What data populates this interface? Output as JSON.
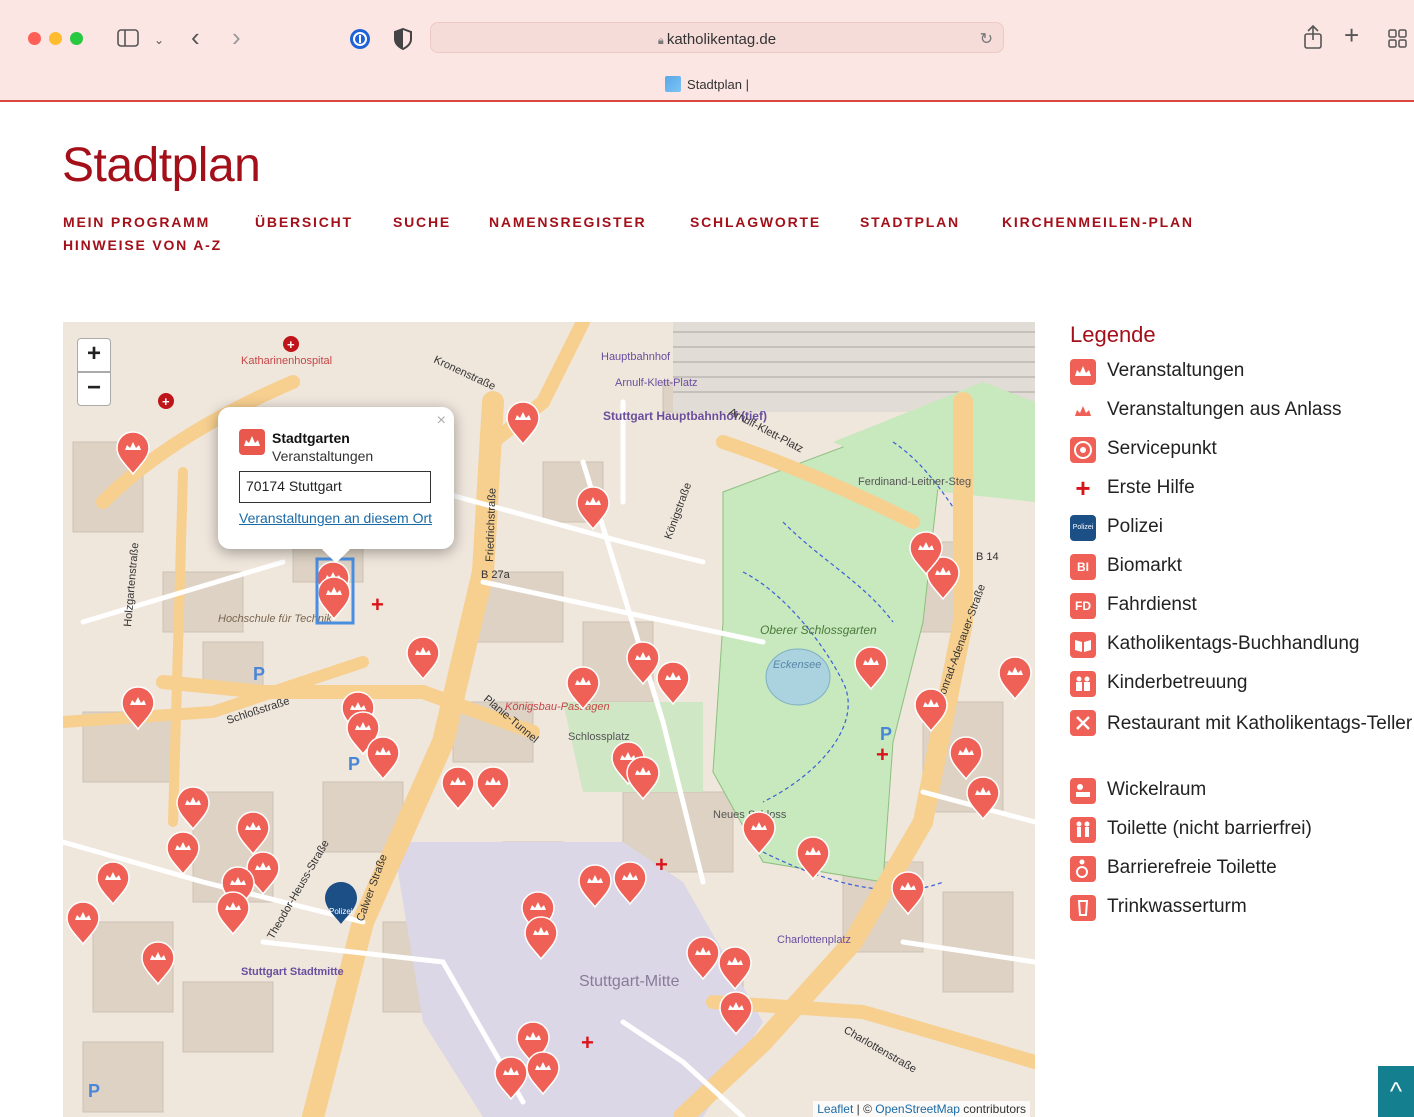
{
  "browser": {
    "url": "katholikentag.de",
    "tab_title": "Stadtplan |"
  },
  "page": {
    "title": "Stadtplan"
  },
  "nav": [
    {
      "label": "MEIN PROGRAMM"
    },
    {
      "label": "ÜBERSICHT"
    },
    {
      "label": "SUCHE"
    },
    {
      "label": "NAMENSREGISTER"
    },
    {
      "label": "SCHLAGWORTE"
    },
    {
      "label": "STADTPLAN"
    },
    {
      "label": "KIRCHENMEILEN-PLAN"
    },
    {
      "label": "HINWEISE VON A-Z"
    }
  ],
  "map": {
    "zoom_in": "+",
    "zoom_out": "−",
    "popup": {
      "close": "×",
      "name": "Stadtgarten",
      "type": "Veranstaltungen",
      "address": "70174 Stuttgart",
      "link": "Veranstaltungen an diesem Ort"
    },
    "labels": [
      {
        "text": "Katharinenhospital"
      },
      {
        "text": "Hauptbahnhof"
      },
      {
        "text": "Arnulf-Klett-Platz"
      },
      {
        "text": "Stuttgart Hauptbahnhof (tief)"
      },
      {
        "text": "Arnulf-Klett-Platz"
      },
      {
        "text": "Ferdinand-Leitner-Steg"
      },
      {
        "text": "Oberer Schlossgarten"
      },
      {
        "text": "Eckensee"
      },
      {
        "text": "Hochschule für Technik"
      },
      {
        "text": "Königsbau-Passagen"
      },
      {
        "text": "Schlossplatz"
      },
      {
        "text": "Neues Schloss"
      },
      {
        "text": "Stuttgart-Mitte"
      },
      {
        "text": "Stuttgart Stadtmitte"
      },
      {
        "text": "Charlottenplatz"
      },
      {
        "text": "Königstraße"
      },
      {
        "text": "Schloßstraße"
      },
      {
        "text": "Theodor-Heuss-Straße"
      },
      {
        "text": "Friedrichstraße"
      },
      {
        "text": "Kronenstraße"
      },
      {
        "text": "Konrad-Adenauer-Straße"
      },
      {
        "text": "Charlottenstraße"
      },
      {
        "text": "Holzgartenstraße"
      },
      {
        "text": "Calwer Straße"
      },
      {
        "text": "Planie-Tunnel"
      },
      {
        "text": "B 27a"
      },
      {
        "text": "B 14"
      }
    ],
    "attribution": {
      "leaflet": "Leaflet",
      "sep": " | © ",
      "osm": "OpenStreetMap",
      "rest": " contributors"
    }
  },
  "legend": {
    "title": "Legende",
    "items": [
      {
        "label": "Veranstaltungen",
        "icon": "event-icon"
      },
      {
        "label": "Veranstaltungen aus Anlass",
        "icon": "event-occasion-icon"
      },
      {
        "label": "Servicepunkt",
        "icon": "service-point-icon"
      },
      {
        "label": "Erste Hilfe",
        "icon": "first-aid-icon"
      },
      {
        "label": "Polizei",
        "icon": "police-icon",
        "badge": "Polizei"
      },
      {
        "label": "Biomarkt",
        "icon": "organic-market-icon",
        "badge": "BI"
      },
      {
        "label": "Fahrdienst",
        "icon": "shuttle-icon",
        "badge": "FD"
      },
      {
        "label": "Katholikentags-Buchhandlung",
        "icon": "bookshop-icon"
      },
      {
        "label": "Kinderbetreuung",
        "icon": "childcare-icon"
      },
      {
        "label": "Restaurant mit Katholikentags-Teller",
        "icon": "restaurant-icon"
      },
      {
        "label": "Wickelraum",
        "icon": "changing-room-icon"
      },
      {
        "label": "Toilette (nicht barrierfrei)",
        "icon": "toilet-icon"
      },
      {
        "label": "Barrierefreie Toilette",
        "icon": "accessible-toilet-icon"
      },
      {
        "label": "Trinkwasserturm",
        "icon": "water-tower-icon"
      }
    ]
  },
  "colors": {
    "brand_red": "#a3101a",
    "marker_red": "#ef6156",
    "police_blue": "#1c4f86",
    "scroll_teal": "#147f8e"
  },
  "scroll_top": "^"
}
